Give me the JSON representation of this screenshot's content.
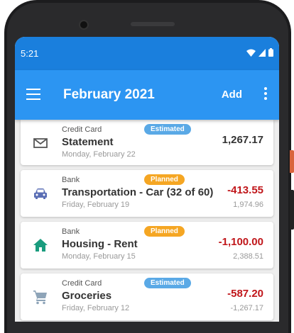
{
  "status": {
    "time": "5:21"
  },
  "appbar": {
    "title": "February 2021",
    "add_label": "Add"
  },
  "transactions": [
    {
      "account": "Credit Card",
      "badge": "Estimated",
      "payee": "Statement",
      "date": "Monday, February 22",
      "amount": "1,267.17",
      "balance": "",
      "icon": "envelope-icon"
    },
    {
      "account": "Bank",
      "badge": "Planned",
      "payee": "Transportation - Car (32 of 60)",
      "date": "Friday, February 19",
      "amount": "-413.55",
      "balance": "1,974.96",
      "icon": "car-icon"
    },
    {
      "account": "Bank",
      "badge": "Planned",
      "payee": "Housing - Rent",
      "date": "Monday, February 15",
      "amount": "-1,100.00",
      "balance": "2,388.51",
      "icon": "home-icon"
    },
    {
      "account": "Credit Card",
      "badge": "Estimated",
      "payee": "Groceries",
      "date": "Friday, February 12",
      "amount": "-587.20",
      "balance": "-1,267.17",
      "icon": "cart-icon"
    }
  ],
  "colors": {
    "appbar": "#2c95f2",
    "statusbar": "#1a7fdd",
    "estimated": "#5aa9e6",
    "planned": "#f5a623",
    "negative": "#c0161a",
    "car_icon": "#5b6fb5",
    "home_icon": "#1a9c7e",
    "cart_icon": "#8ea4b8"
  }
}
